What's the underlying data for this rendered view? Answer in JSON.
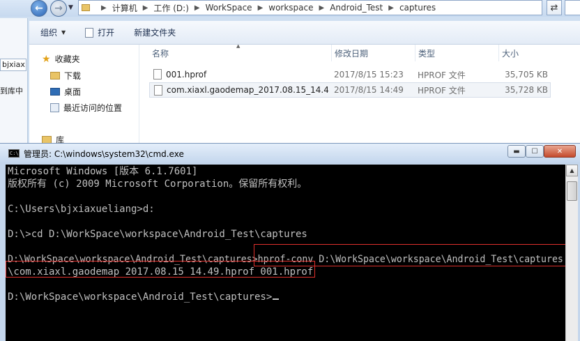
{
  "explorer": {
    "breadcrumb": [
      "计算机",
      "工作 (D:)",
      "WorkSpace",
      "workspace",
      "Android_Test",
      "captures"
    ],
    "toolbar": {
      "organize": "组织",
      "open": "打开",
      "new_folder": "新建文件夹"
    },
    "background_window": {
      "tab_text": "bjxiax",
      "text": "到库中"
    },
    "nav": {
      "favorites": "收藏夹",
      "downloads": "下载",
      "desktop": "桌面",
      "recent": "最近访问的位置",
      "libraries": "库"
    },
    "columns": {
      "name": "名称",
      "modified": "修改日期",
      "type": "类型",
      "size": "大小"
    },
    "files": [
      {
        "name": "001.hprof",
        "modified": "2017/8/15 15:23",
        "type": "HPROF 文件",
        "size": "35,705 KB"
      },
      {
        "name": "com.xiaxl.gaodemap_2017.08.15_14.4...",
        "modified": "2017/8/15 14:49",
        "type": "HPROF 文件",
        "size": "35,728 KB"
      }
    ]
  },
  "cmd": {
    "title": "管理员: C:\\windows\\system32\\cmd.exe",
    "icon_text": "C:\\",
    "lines": [
      "Microsoft Windows [版本 6.1.7601]",
      "版权所有 (c) 2009 Microsoft Corporation。保留所有权利。",
      "C:\\Users\\bjxiaxueliang>d:",
      "D:\\>cd D:\\WorkSpace\\workspace\\Android_Test\\captures",
      "D:\\WorkSpace\\workspace\\Android_Test\\captures>hprof-conv D:\\WorkSpace\\workspace\\Android_Test\\captures",
      "\\com.xiaxl.gaodemap_2017.08.15_14.49.hprof 001.hprof",
      "D:\\WorkSpace\\workspace\\Android_Test\\captures>"
    ],
    "highlight_color": "#e0302c"
  },
  "icons": {
    "back": "back-arrow-icon",
    "forward": "forward-arrow-icon",
    "favorites": "star-icon",
    "file": "file-icon"
  }
}
